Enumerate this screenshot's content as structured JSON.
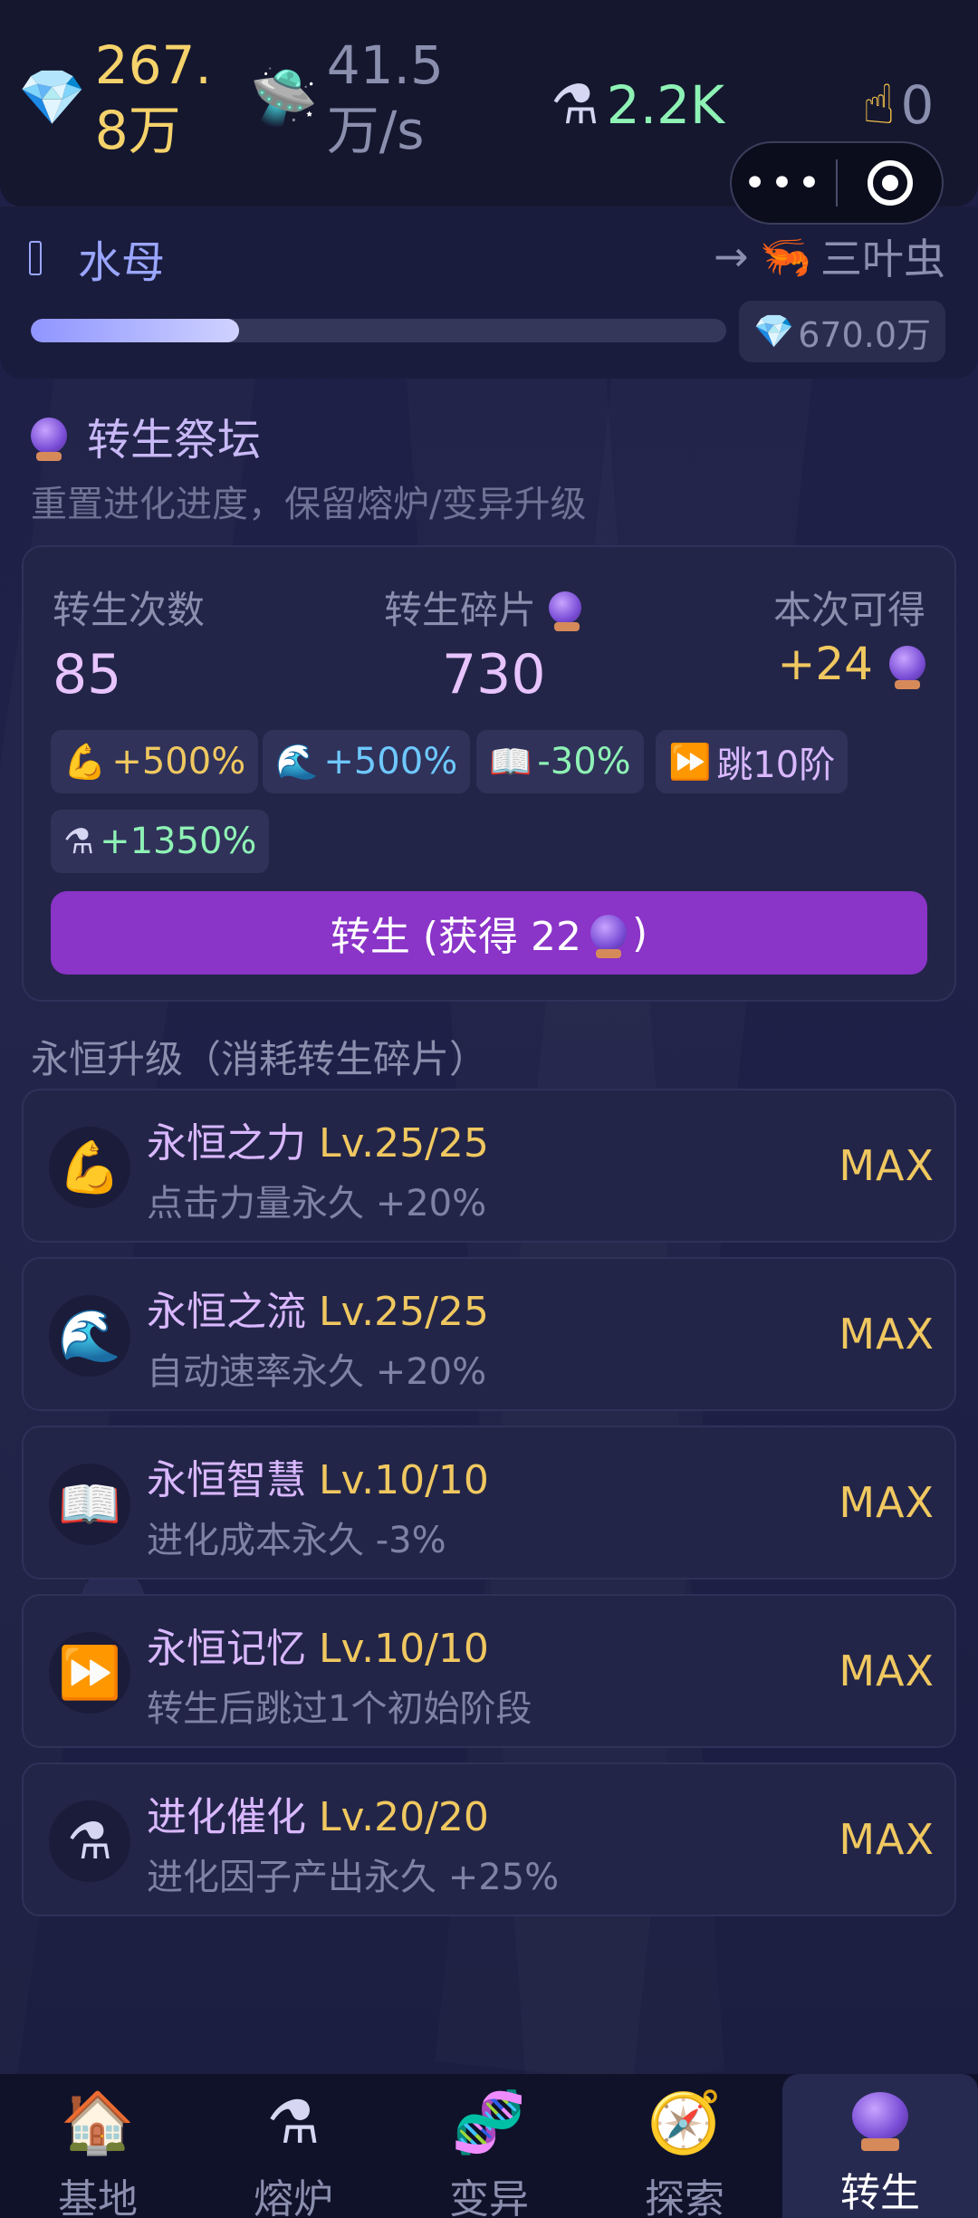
{
  "resources": {
    "gems": {
      "icon": "gem-icon",
      "line1": "267.",
      "line2": "8万"
    },
    "rate": {
      "icon": "ufo-icon",
      "line1": "41.5",
      "line2": "万/s"
    },
    "factor": {
      "icon": "furnace-icon",
      "value": "2.2K"
    },
    "clicks": {
      "icon": "pointing-hand-icon",
      "value": "0"
    }
  },
  "capsule": {
    "more": "•••"
  },
  "stage": {
    "current": "水母",
    "arrow": "→",
    "next": "三叶虫",
    "progress": 0.3,
    "cost": "670.0万"
  },
  "altar": {
    "title": "转生祭坛",
    "subtitle": "重置进化进度，保留熔炉/变异升级",
    "count_label": "转生次数",
    "count": "85",
    "shards_label": "转生碎片",
    "shards": "730",
    "gain_label": "本次可得",
    "gain": "+24",
    "chips": [
      {
        "icon": "muscle-icon",
        "text": "+500%",
        "color": "#f0c860"
      },
      {
        "icon": "wave-icon",
        "text": "+500%",
        "color": "#6ec8ff"
      },
      {
        "icon": "book-icon",
        "text": "-30%",
        "color": "#8ef2b5"
      },
      {
        "icon": "fast-forward-icon",
        "text": "跳10阶",
        "color": "#d9b8ff"
      },
      {
        "icon": "furnace-icon",
        "text": "+1350%",
        "color": "#8ef2b5"
      }
    ],
    "button_prefix": "转生 (获得 22",
    "button_suffix": ")"
  },
  "upgrades_title": "永恒升级（消耗转生碎片）",
  "upgrades": [
    {
      "icon": "muscle-icon",
      "name": "永恒之力",
      "level": "Lv.25/25",
      "desc": "点击力量永久 +20%",
      "status": "MAX"
    },
    {
      "icon": "wave-icon",
      "name": "永恒之流",
      "level": "Lv.25/25",
      "desc": "自动速率永久 +20%",
      "status": "MAX"
    },
    {
      "icon": "book-icon",
      "name": "永恒智慧",
      "level": "Lv.10/10",
      "desc": "进化成本永久 -3%",
      "status": "MAX"
    },
    {
      "icon": "fast-forward-icon",
      "name": "永恒记忆",
      "level": "Lv.10/10",
      "desc": "转生后跳过1个初始阶段",
      "status": "MAX"
    },
    {
      "icon": "furnace-icon",
      "name": "进化催化",
      "level": "Lv.20/20",
      "desc": "进化因子产出永久 +25%",
      "status": "MAX"
    }
  ],
  "nav": [
    {
      "icon": "house-icon",
      "label": "基地"
    },
    {
      "icon": "furnace-icon",
      "label": "熔炉"
    },
    {
      "icon": "dna-icon",
      "label": "变异"
    },
    {
      "icon": "compass-icon",
      "label": "探索"
    },
    {
      "icon": "crystal-ball-icon",
      "label": "转生"
    }
  ],
  "active_tab": 4
}
